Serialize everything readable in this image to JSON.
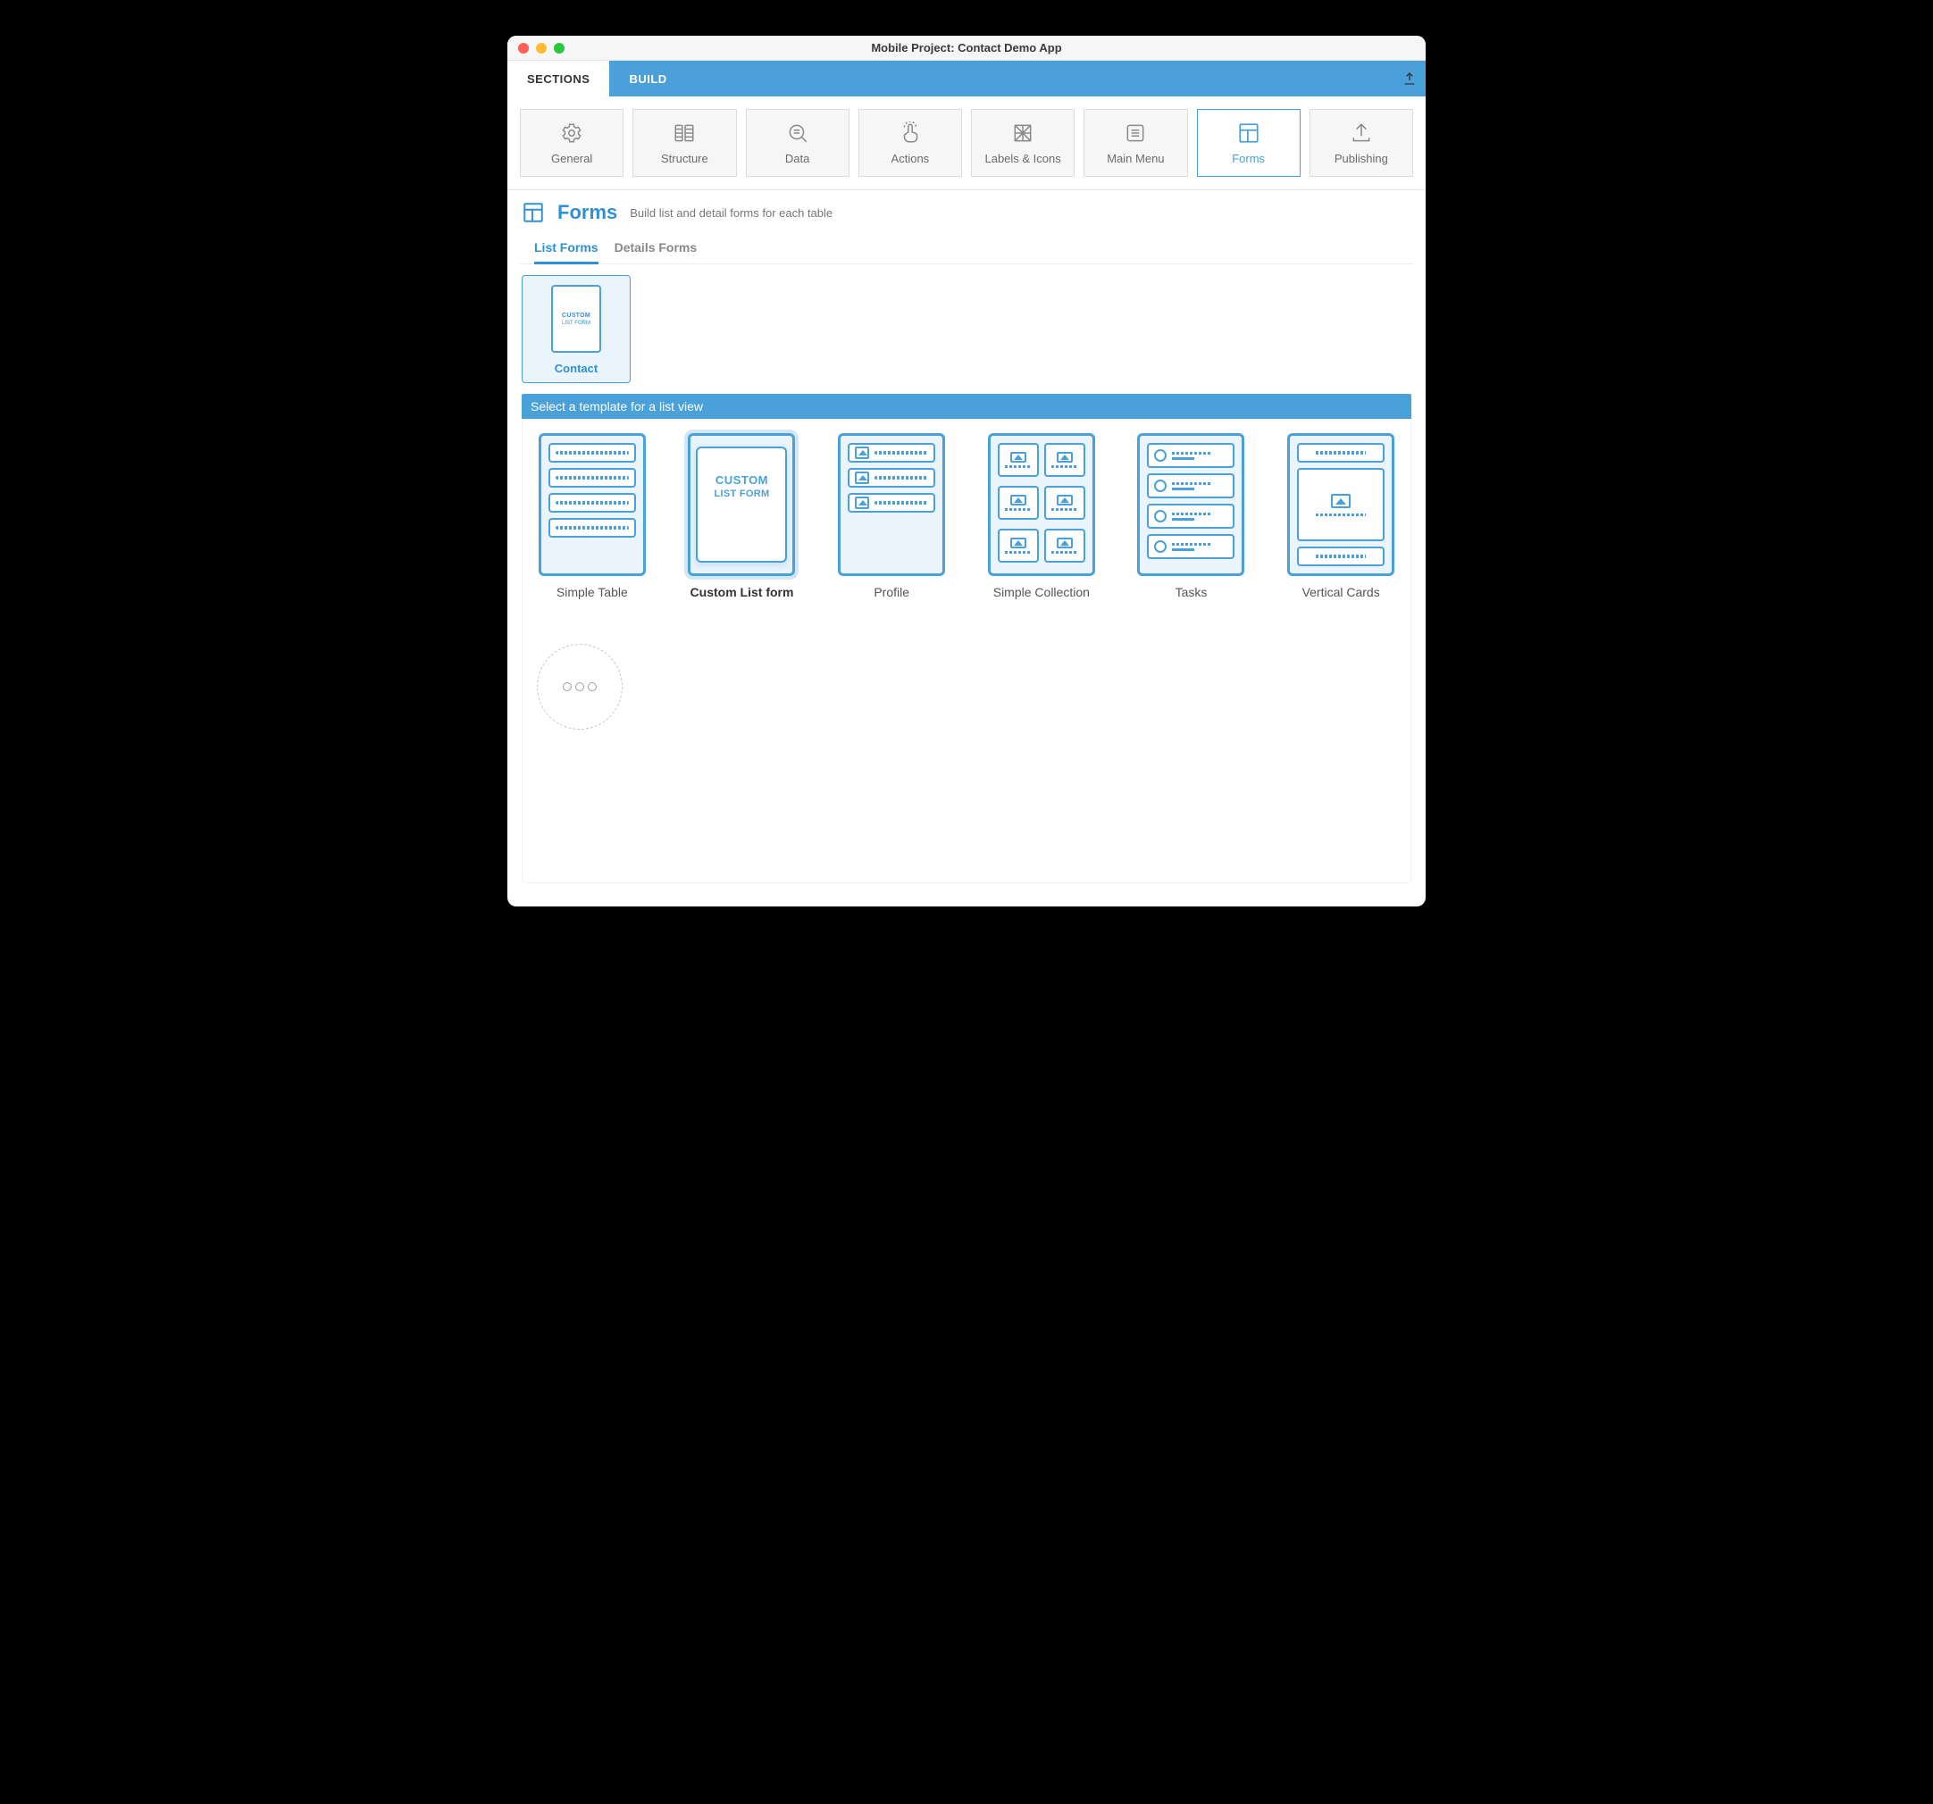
{
  "window": {
    "title": "Mobile Project: Contact Demo App"
  },
  "tabs": {
    "sections": "SECTIONS",
    "build": "BUILD"
  },
  "sections": [
    {
      "id": "general",
      "label": "General"
    },
    {
      "id": "structure",
      "label": "Structure"
    },
    {
      "id": "data",
      "label": "Data"
    },
    {
      "id": "actions",
      "label": "Actions"
    },
    {
      "id": "labels",
      "label": "Labels & Icons"
    },
    {
      "id": "mainmenu",
      "label": "Main Menu"
    },
    {
      "id": "forms",
      "label": "Forms",
      "active": true
    },
    {
      "id": "publishing",
      "label": "Publishing"
    }
  ],
  "header": {
    "title": "Forms",
    "subtitle": "Build list and detail forms for each table"
  },
  "subtabs": {
    "list": "List Forms",
    "details": "Details Forms"
  },
  "tables": [
    {
      "name": "Contact",
      "icon_line1": "CUSTOM",
      "icon_line2": "LIST FORM"
    }
  ],
  "template_header": "Select a template for a list view",
  "templates": [
    {
      "id": "simple-table",
      "label": "Simple Table",
      "kind": "rows"
    },
    {
      "id": "custom-list-form",
      "label": "Custom List form",
      "kind": "custom",
      "selected": true,
      "line1": "CUSTOM",
      "line2": "LIST FORM"
    },
    {
      "id": "profile",
      "label": "Profile",
      "kind": "profile"
    },
    {
      "id": "simple-collection",
      "label": "Simple Collection",
      "kind": "grid"
    },
    {
      "id": "tasks",
      "label": "Tasks",
      "kind": "tasks"
    },
    {
      "id": "vertical-cards",
      "label": "Vertical Cards",
      "kind": "vcards"
    }
  ]
}
